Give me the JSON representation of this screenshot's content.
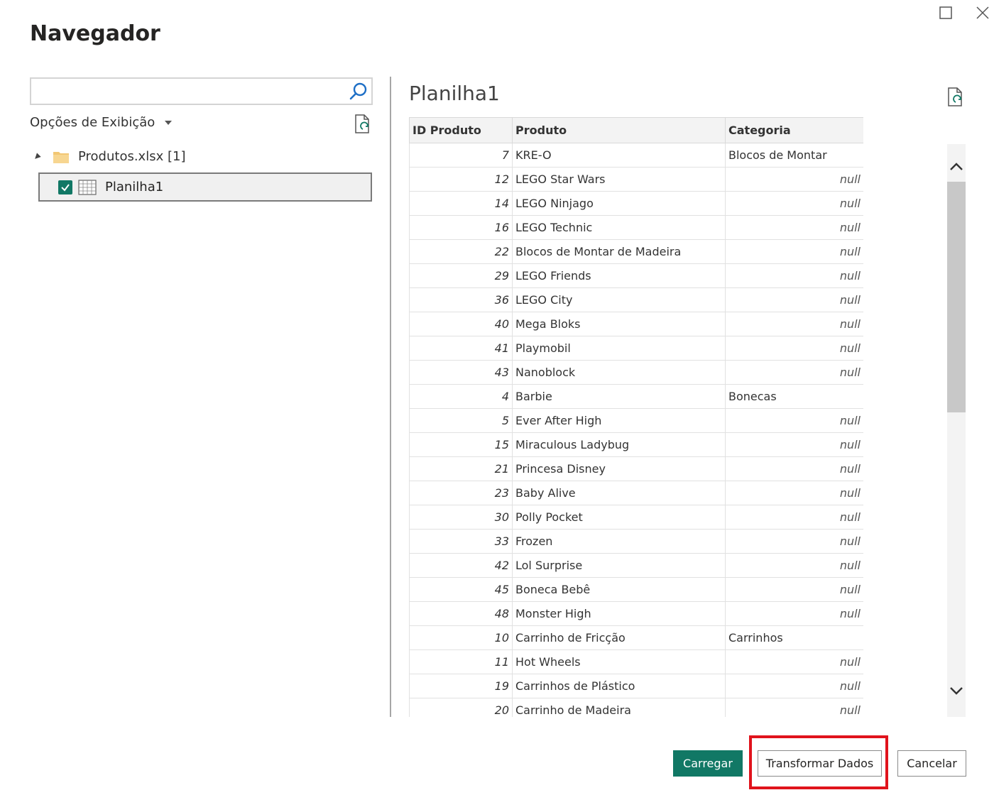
{
  "window": {
    "title": "Navegador"
  },
  "search": {
    "placeholder": "",
    "value": ""
  },
  "view_options": {
    "label": "Opções de Exibição"
  },
  "tree": {
    "file": {
      "label": "Produtos.xlsx [1]"
    },
    "sheet": {
      "label": "Planilha1",
      "checked": true
    }
  },
  "preview": {
    "title": "Planilha1",
    "columns": [
      "ID Produto",
      "Produto",
      "Categoria"
    ],
    "rows": [
      [
        "7",
        "KRE-O",
        "Blocos de Montar"
      ],
      [
        "12",
        "LEGO Star Wars",
        "null"
      ],
      [
        "14",
        "LEGO Ninjago",
        "null"
      ],
      [
        "16",
        "LEGO Technic",
        "null"
      ],
      [
        "22",
        "Blocos de Montar de Madeira",
        "null"
      ],
      [
        "29",
        "LEGO Friends",
        "null"
      ],
      [
        "36",
        "LEGO City",
        "null"
      ],
      [
        "40",
        "Mega Bloks",
        "null"
      ],
      [
        "41",
        "Playmobil",
        "null"
      ],
      [
        "43",
        "Nanoblock",
        "null"
      ],
      [
        "4",
        "Barbie",
        "Bonecas"
      ],
      [
        "5",
        "Ever After High",
        "null"
      ],
      [
        "15",
        "Miraculous Ladybug",
        "null"
      ],
      [
        "21",
        "Princesa Disney",
        "null"
      ],
      [
        "23",
        "Baby Alive",
        "null"
      ],
      [
        "30",
        "Polly Pocket",
        "null"
      ],
      [
        "33",
        "Frozen",
        "null"
      ],
      [
        "42",
        "Lol Surprise",
        "null"
      ],
      [
        "45",
        "Boneca Bebê",
        "null"
      ],
      [
        "48",
        "Monster High",
        "null"
      ],
      [
        "10",
        "Carrinho de Fricção",
        "Carrinhos"
      ],
      [
        "11",
        "Hot Wheels",
        "null"
      ],
      [
        "19",
        "Carrinhos de Plástico",
        "null"
      ],
      [
        "20",
        "Carrinho de Madeira",
        "null"
      ]
    ]
  },
  "buttons": {
    "load": "Carregar",
    "transform": "Transformar Dados",
    "cancel": "Cancelar"
  },
  "colors": {
    "accent": "#117865",
    "highlight": "#e0131c"
  }
}
